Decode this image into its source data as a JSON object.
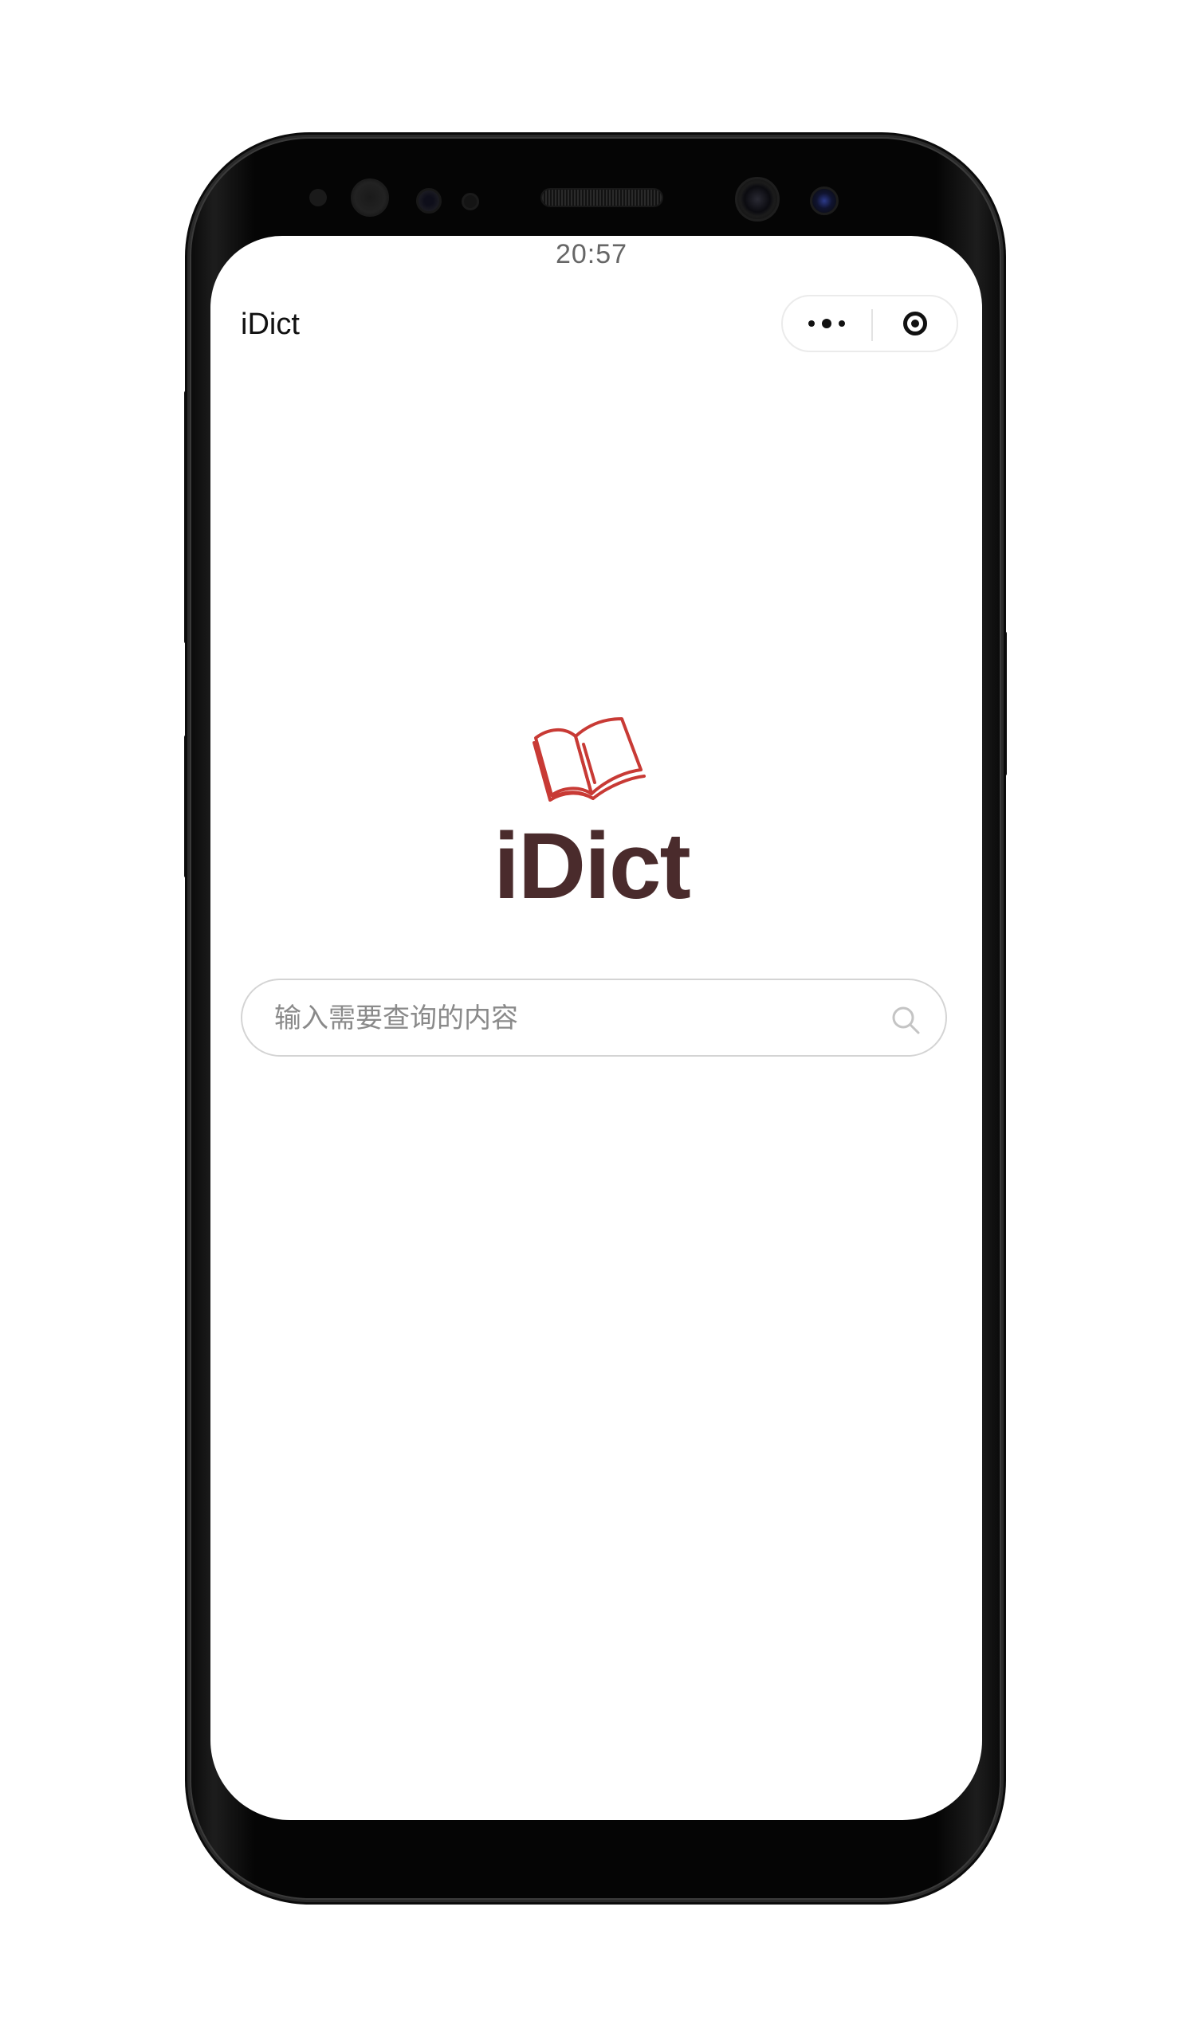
{
  "status_bar": {
    "time": "20:57"
  },
  "nav_bar": {
    "title": "iDict"
  },
  "capsule": {
    "more_icon": "more-dots-icon",
    "close_icon": "target-circle-icon"
  },
  "logo": {
    "icon": "open-book-icon",
    "text": "iDict",
    "icon_color": "#c83a35",
    "text_color": "#4a2b2c"
  },
  "search": {
    "placeholder": "输入需要查询的内容",
    "value": "",
    "icon": "search-icon"
  }
}
